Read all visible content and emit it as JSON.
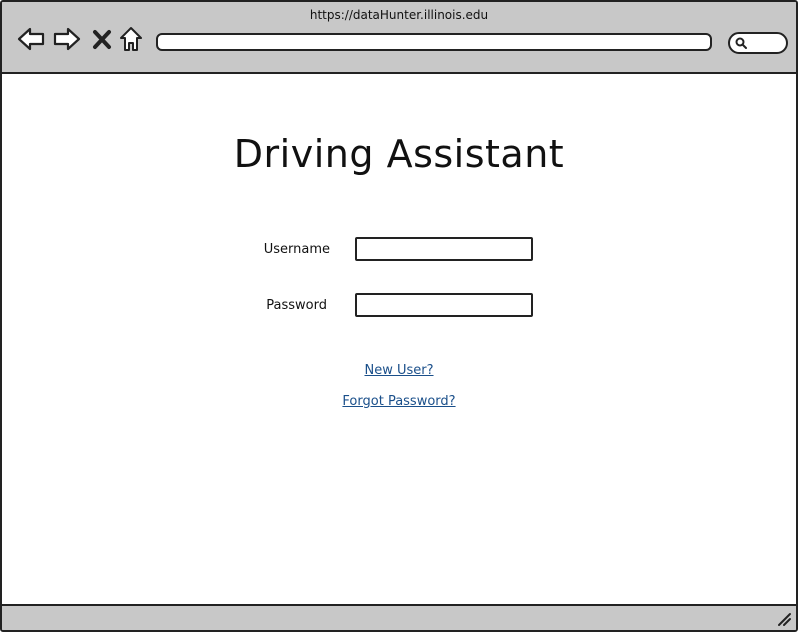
{
  "browser": {
    "url": "https://dataHunter.illinois.edu",
    "icons": [
      "back-arrow-icon",
      "forward-arrow-icon",
      "close-icon",
      "home-icon",
      "search-icon",
      "resize-grip-icon"
    ]
  },
  "page": {
    "title": "Driving Assistant"
  },
  "login_form": {
    "username_label": "Username",
    "username_value": "",
    "password_label": "Password",
    "password_value": ""
  },
  "links": {
    "new_user": "New User?",
    "forgot_password": "Forgot Password?"
  },
  "colors": {
    "chrome": "#c8c8c8",
    "link": "#1a4f8a",
    "border": "#222222"
  }
}
